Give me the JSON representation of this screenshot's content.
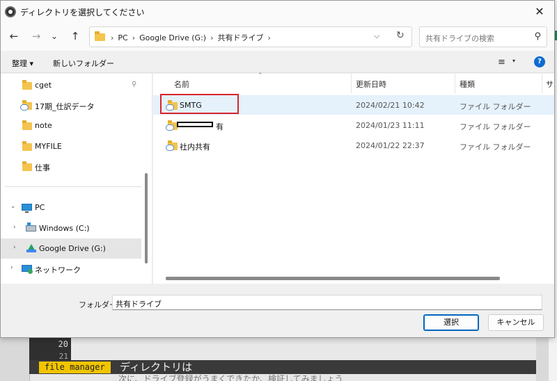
{
  "background": {
    "line_20": "20",
    "line_21": "21",
    "status_badge": "file manager",
    "status_text": "ディレクトリは",
    "below_text": "次に、ドライブ登録がうまくできたか、検証してみましょう"
  },
  "dialog": {
    "title": "ディレクトリを選択してください",
    "close_glyph": "✕"
  },
  "toolbar": {
    "back_glyph": "←",
    "forward_glyph": "→",
    "recent_glyph": "⌄",
    "up_glyph": "↑",
    "breadcrumbs": [
      "PC",
      "Google Drive (G:)",
      "共有ドライブ"
    ],
    "chevron_glyph": "⌵",
    "refresh_glyph": "↻",
    "search_placeholder": "共有ドライブの検索",
    "search_glyph": "⚲"
  },
  "cmdbar": {
    "organize": "整理 ▾",
    "new_folder": "新しいフォルダー",
    "view_glyph": "≡",
    "view_caret": "▾",
    "help": "?"
  },
  "nav": {
    "quick": [
      "cget",
      "17期_仕訳データ",
      "note",
      "MYFILE",
      "仕事"
    ],
    "pc": "PC",
    "windows": "Windows (C:)",
    "gdrive": "Google Drive (G:)",
    "network": "ネットワーク",
    "expanded_glyph": "⌄",
    "collapsed_glyph": "›",
    "pin_glyph": "⚲"
  },
  "columns": {
    "name": "名前",
    "date": "更新日時",
    "type": "種類",
    "size": "サ"
  },
  "files": [
    {
      "name": "SMTG",
      "date": "2024/02/21 10:42",
      "type": "ファイル フォルダー"
    },
    {
      "name": "有",
      "date": "2024/01/23 11:11",
      "type": "ファイル フォルダー"
    },
    {
      "name": "社内共有",
      "date": "2024/01/22 22:37",
      "type": "ファイル フォルダー"
    }
  ],
  "bottom": {
    "folder_label": "フォルダー:",
    "folder_value": "共有ドライブ",
    "select": "選択",
    "cancel": "キャンセル"
  },
  "colors": {
    "highlight_box": "#d9232d",
    "primary_button_border": "#0067c0",
    "selected_row": "#e5f1fb"
  }
}
